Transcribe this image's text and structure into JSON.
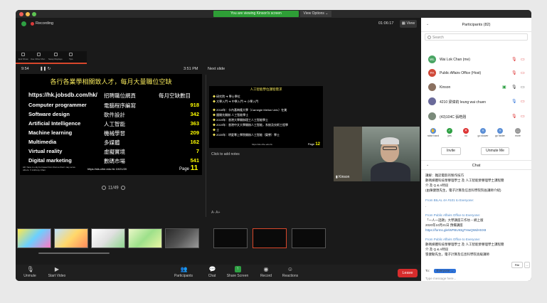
{
  "window": {
    "viewing_banner": "You are viewing Kinson's screen",
    "view_options": "View Options ⌄"
  },
  "topbar": {
    "recording_label": "Recording",
    "timer": "01:06:17",
    "view_label": "View"
  },
  "presenter_view": {
    "clock": "9:54",
    "current_time": "3:51 PM",
    "next_slide_label": "Next slide",
    "ppt_tools": [
      "End Show",
      "Use Other Mon",
      "Swap Displays",
      "Tips"
    ],
    "notes_placeholder": "Click to add notes",
    "font_size_label": "A- A+",
    "pager": "11/49"
  },
  "slide": {
    "title": "各行各業學相關致人才，每月大量職位空缺",
    "url": "https://hk.jobsdb.com/hk/",
    "col2_header": "招聘職位網頁",
    "col3_header": "每月空缺數目",
    "rows": [
      {
        "en": "Computer programmer",
        "zh": "電腦程序編寫",
        "num": "918"
      },
      {
        "en": "Software design",
        "zh": "軟件設計",
        "num": "342"
      },
      {
        "en": "Artificial Intelligence",
        "zh": "人工智能",
        "num": "363"
      },
      {
        "en": "Machine learning",
        "zh": "機械學習",
        "num": "209"
      },
      {
        "en": "Multimedia",
        "zh": "多媒體",
        "num": "162"
      },
      {
        "en": "Virtual reality",
        "zh": "虛擬實境",
        "num": "7"
      },
      {
        "en": "Digital marketing",
        "zh": "數碼市場",
        "num": "541"
      }
    ],
    "footnote": "All I have is only borrowed from that so that I may serve others. © Anthony Chan",
    "source": "https://sls.cihe.edu.hk      10/21/20",
    "page_label": "Page",
    "page_number": "11"
  },
  "next_slide": {
    "title": "人工智能學位課程需求",
    "lines": [
      "研究院 ➔ 學士學位",
      "大學入門 ➔ 中學入門 ➔ 小學入門",
      "2018年：卡內基梅隆大學（Carnegie Mellon Univ）在美",
      "國開先開辦 人工智能學士",
      "2019年：香港大學開辦理工人工智能學士",
      "2019年：香港中文大學開辦人工智能，系統及技術工程學",
      "士",
      "2020年：明愛專上學院開辦人工智能（榮譽）學士"
    ],
    "source": "https://sls.cihe.edu.hk",
    "page_label": "Page",
    "page_number": "12"
  },
  "video": {
    "name": "Kinson"
  },
  "toolbar": {
    "unmute": "Unmute",
    "start_video": "Start Video",
    "participants": "Participants",
    "participants_count": "82",
    "chat": "Chat",
    "share_screen": "Share Screen",
    "record": "Record",
    "reactions": "Reactions",
    "leave": "Leave"
  },
  "participants_panel": {
    "title": "Participants (82)",
    "search_placeholder": "Search",
    "people": [
      {
        "initials": "WL",
        "name": "Wai Lok Chan (me)",
        "color": "#4aa564"
      },
      {
        "initials": "PA",
        "name": "Public Affairs Office (Host)",
        "color": "#d04a3a"
      },
      {
        "initials": "",
        "name": "Kinson",
        "color": "#8a7060"
      },
      {
        "initials": "",
        "name": "4210 梁偉鈞 leung wai chuen",
        "color": "#6a6a9a"
      },
      {
        "initials": "",
        "name": "(43)104C 張皓翹",
        "color": "#7a8a7a"
      }
    ],
    "reactions": [
      "raise hand",
      "yes",
      "no",
      "go slower",
      "go faster",
      "more"
    ],
    "invite": "Invite",
    "unmute_me": "Unmute Me"
  },
  "chat_panel": {
    "title": "Chat",
    "lines": [
      {
        "t": "講解：雜誌電影的製作技巧",
        "k": "msg"
      },
      {
        "t": "數碼媒體科技榮譽理學士 及 人工智能榮譽理學士課程簡",
        "k": "msg"
      },
      {
        "t": "介 及 Q & A時段",
        "k": "msg"
      },
      {
        "t": "(由陳健匯先生，電子計算及信息科學院院長講師介紹)",
        "k": "msg"
      },
      {
        "t": "From BILAL 4A #101 to Everyone:",
        "k": "from"
      },
      {
        "t": ".",
        "k": "msg"
      },
      {
        "t": "From Public Affairs Office to Everyone:",
        "k": "from"
      },
      {
        "t": "「一人一話題」大學講座工作坊 – 網上版",
        "k": "msg"
      },
      {
        "t": "2020年10月21日 預備講座",
        "k": "msg"
      },
      {
        "t": "https://forms.gle/WFBU93gTHwQWdHSX8",
        "k": "link"
      },
      {
        "t": "From Public Affairs Office to Everyone:",
        "k": "from"
      },
      {
        "t": "數碼媒體科技榮譽理學士 及 人工智能榮譽理學士課程簡",
        "k": "msg"
      },
      {
        "t": "介 及 Q & A時段",
        "k": "msg"
      },
      {
        "t": "張健勳先生，電子計算及信息科學院高級講師",
        "k": "msg"
      }
    ],
    "to_label": "To:",
    "everyone": "Everyone ⌄",
    "file": "File",
    "more": "...",
    "placeholder": "Type message here..."
  }
}
